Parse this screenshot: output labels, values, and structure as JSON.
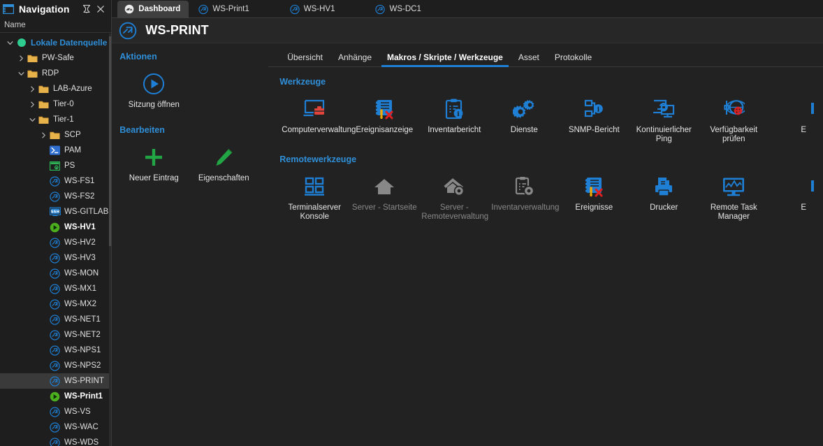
{
  "nav": {
    "title": "Navigation",
    "window_icon": "window-layout-icon",
    "pin_icon": "pin-icon",
    "close_icon": "close-icon",
    "column_header": "Name",
    "tree": [
      {
        "label": "Lokale Datenquelle",
        "indent": 0,
        "twisty": "down",
        "icon": "green-circle-icon",
        "style": "root"
      },
      {
        "label": "PW-Safe",
        "indent": 1,
        "twisty": "right",
        "icon": "folder-icon",
        "style": ""
      },
      {
        "label": "RDP",
        "indent": 1,
        "twisty": "down",
        "icon": "folder-icon",
        "style": ""
      },
      {
        "label": "LAB-Azure",
        "indent": 2,
        "twisty": "right",
        "icon": "folder-icon",
        "style": ""
      },
      {
        "label": "Tier-0",
        "indent": 2,
        "twisty": "right",
        "icon": "folder-icon",
        "style": ""
      },
      {
        "label": "Tier-1",
        "indent": 2,
        "twisty": "down",
        "icon": "folder-icon",
        "style": ""
      },
      {
        "label": "SCP",
        "indent": 3,
        "twisty": "right",
        "icon": "folder-icon",
        "style": ""
      },
      {
        "label": "PAM",
        "indent": 3,
        "twisty": "none",
        "icon": "powershell-icon",
        "style": ""
      },
      {
        "label": "PS",
        "indent": 3,
        "twisty": "none",
        "icon": "putty-lock-icon",
        "style": ""
      },
      {
        "label": "WS-FS1",
        "indent": 3,
        "twisty": "none",
        "icon": "rdp-icon",
        "style": ""
      },
      {
        "label": "WS-FS2",
        "indent": 3,
        "twisty": "none",
        "icon": "rdp-icon",
        "style": ""
      },
      {
        "label": "WS-GITLAB",
        "indent": 3,
        "twisty": "none",
        "icon": "ssh-icon",
        "style": ""
      },
      {
        "label": "WS-HV1",
        "indent": 3,
        "twisty": "none",
        "icon": "connected-play-icon",
        "style": "active"
      },
      {
        "label": "WS-HV2",
        "indent": 3,
        "twisty": "none",
        "icon": "rdp-icon",
        "style": ""
      },
      {
        "label": "WS-HV3",
        "indent": 3,
        "twisty": "none",
        "icon": "rdp-icon",
        "style": ""
      },
      {
        "label": "WS-MON",
        "indent": 3,
        "twisty": "none",
        "icon": "rdp-icon",
        "style": ""
      },
      {
        "label": "WS-MX1",
        "indent": 3,
        "twisty": "none",
        "icon": "rdp-icon",
        "style": ""
      },
      {
        "label": "WS-MX2",
        "indent": 3,
        "twisty": "none",
        "icon": "rdp-icon",
        "style": ""
      },
      {
        "label": "WS-NET1",
        "indent": 3,
        "twisty": "none",
        "icon": "rdp-icon",
        "style": ""
      },
      {
        "label": "WS-NET2",
        "indent": 3,
        "twisty": "none",
        "icon": "rdp-icon",
        "style": ""
      },
      {
        "label": "WS-NPS1",
        "indent": 3,
        "twisty": "none",
        "icon": "rdp-icon",
        "style": ""
      },
      {
        "label": "WS-NPS2",
        "indent": 3,
        "twisty": "none",
        "icon": "rdp-icon",
        "style": ""
      },
      {
        "label": "WS-PRINT",
        "indent": 3,
        "twisty": "none",
        "icon": "rdp-icon",
        "style": "selected"
      },
      {
        "label": "WS-Print1",
        "indent": 3,
        "twisty": "none",
        "icon": "connected-play-icon",
        "style": "active"
      },
      {
        "label": "WS-VS",
        "indent": 3,
        "twisty": "none",
        "icon": "rdp-icon",
        "style": ""
      },
      {
        "label": "WS-WAC",
        "indent": 3,
        "twisty": "none",
        "icon": "rdp-icon",
        "style": ""
      },
      {
        "label": "WS-WDS",
        "indent": 3,
        "twisty": "none",
        "icon": "rdp-icon",
        "style": ""
      }
    ]
  },
  "tabs": [
    {
      "label": "Dashboard",
      "icon": "dashboard-gauge-icon",
      "active": true
    },
    {
      "label": "WS-Print1",
      "icon": "rdp-icon",
      "active": false
    },
    {
      "label": "WS-HV1",
      "icon": "rdp-icon",
      "active": false
    },
    {
      "label": "WS-DC1",
      "icon": "rdp-icon",
      "active": false
    }
  ],
  "entry": {
    "icon": "rdp-icon",
    "title": "WS-PRINT"
  },
  "actions": {
    "section_actions": "Aktionen",
    "section_edit": "Bearbeiten",
    "items_actions": [
      {
        "label": "Sitzung öffnen",
        "icon": "play-circle-icon"
      }
    ],
    "items_edit": [
      {
        "label": "Neuer Eintrag",
        "icon": "plus-icon"
      },
      {
        "label": "Eigenschaften",
        "icon": "pencil-icon"
      }
    ]
  },
  "subtabs": [
    {
      "label": "Übersicht",
      "active": false
    },
    {
      "label": "Anhänge",
      "active": false
    },
    {
      "label": "Makros / Skripte / Werkzeuge",
      "active": true
    },
    {
      "label": "Asset",
      "active": false
    },
    {
      "label": "Protokolle",
      "active": false
    }
  ],
  "tools": {
    "section_werkzeuge": "Werkzeuge",
    "section_remote": "Remotewerkzeuge",
    "werkzeuge": [
      {
        "label": "Computerverwaltung",
        "icon": "computer-management-icon",
        "disabled": false
      },
      {
        "label": "Ereignisanzeige",
        "icon": "event-viewer-icon",
        "disabled": false
      },
      {
        "label": "Inventarbericht",
        "icon": "inventory-report-icon",
        "disabled": false
      },
      {
        "label": "Dienste",
        "icon": "services-gears-icon",
        "disabled": false
      },
      {
        "label": "SNMP-Bericht",
        "icon": "snmp-report-icon",
        "disabled": false
      },
      {
        "label": "Kontinuierlicher Ping",
        "icon": "continuous-ping-icon",
        "disabled": false
      },
      {
        "label": "Verfügbarkeit prüfen",
        "icon": "availability-check-icon",
        "disabled": false
      },
      {
        "label": "E",
        "icon": "cut-off-icon",
        "disabled": false
      }
    ],
    "remote": [
      {
        "label": "Terminalserver Konsole",
        "icon": "terminal-server-icon",
        "disabled": false
      },
      {
        "label": "Server - Startseite",
        "icon": "server-home-icon",
        "disabled": true
      },
      {
        "label": "Server - Remoteverwaltung",
        "icon": "server-manage-icon",
        "disabled": true
      },
      {
        "label": "Inventarverwaltung",
        "icon": "inventory-manage-icon",
        "disabled": true
      },
      {
        "label": "Ereignisse",
        "icon": "event-viewer-icon",
        "disabled": false
      },
      {
        "label": "Drucker",
        "icon": "printer-icon",
        "disabled": false
      },
      {
        "label": "Remote Task Manager",
        "icon": "task-manager-icon",
        "disabled": false
      },
      {
        "label": "E",
        "icon": "cut-off-icon",
        "disabled": false
      }
    ]
  },
  "colors": {
    "accent_blue": "#1e7fd4",
    "link_blue": "#2f8fd8",
    "green": "#22a544",
    "red": "#e02020",
    "folder": "#e8b24a",
    "bg": "#222222",
    "panel_bg": "#1e1e1e",
    "selected_row": "#3a3a3a"
  }
}
